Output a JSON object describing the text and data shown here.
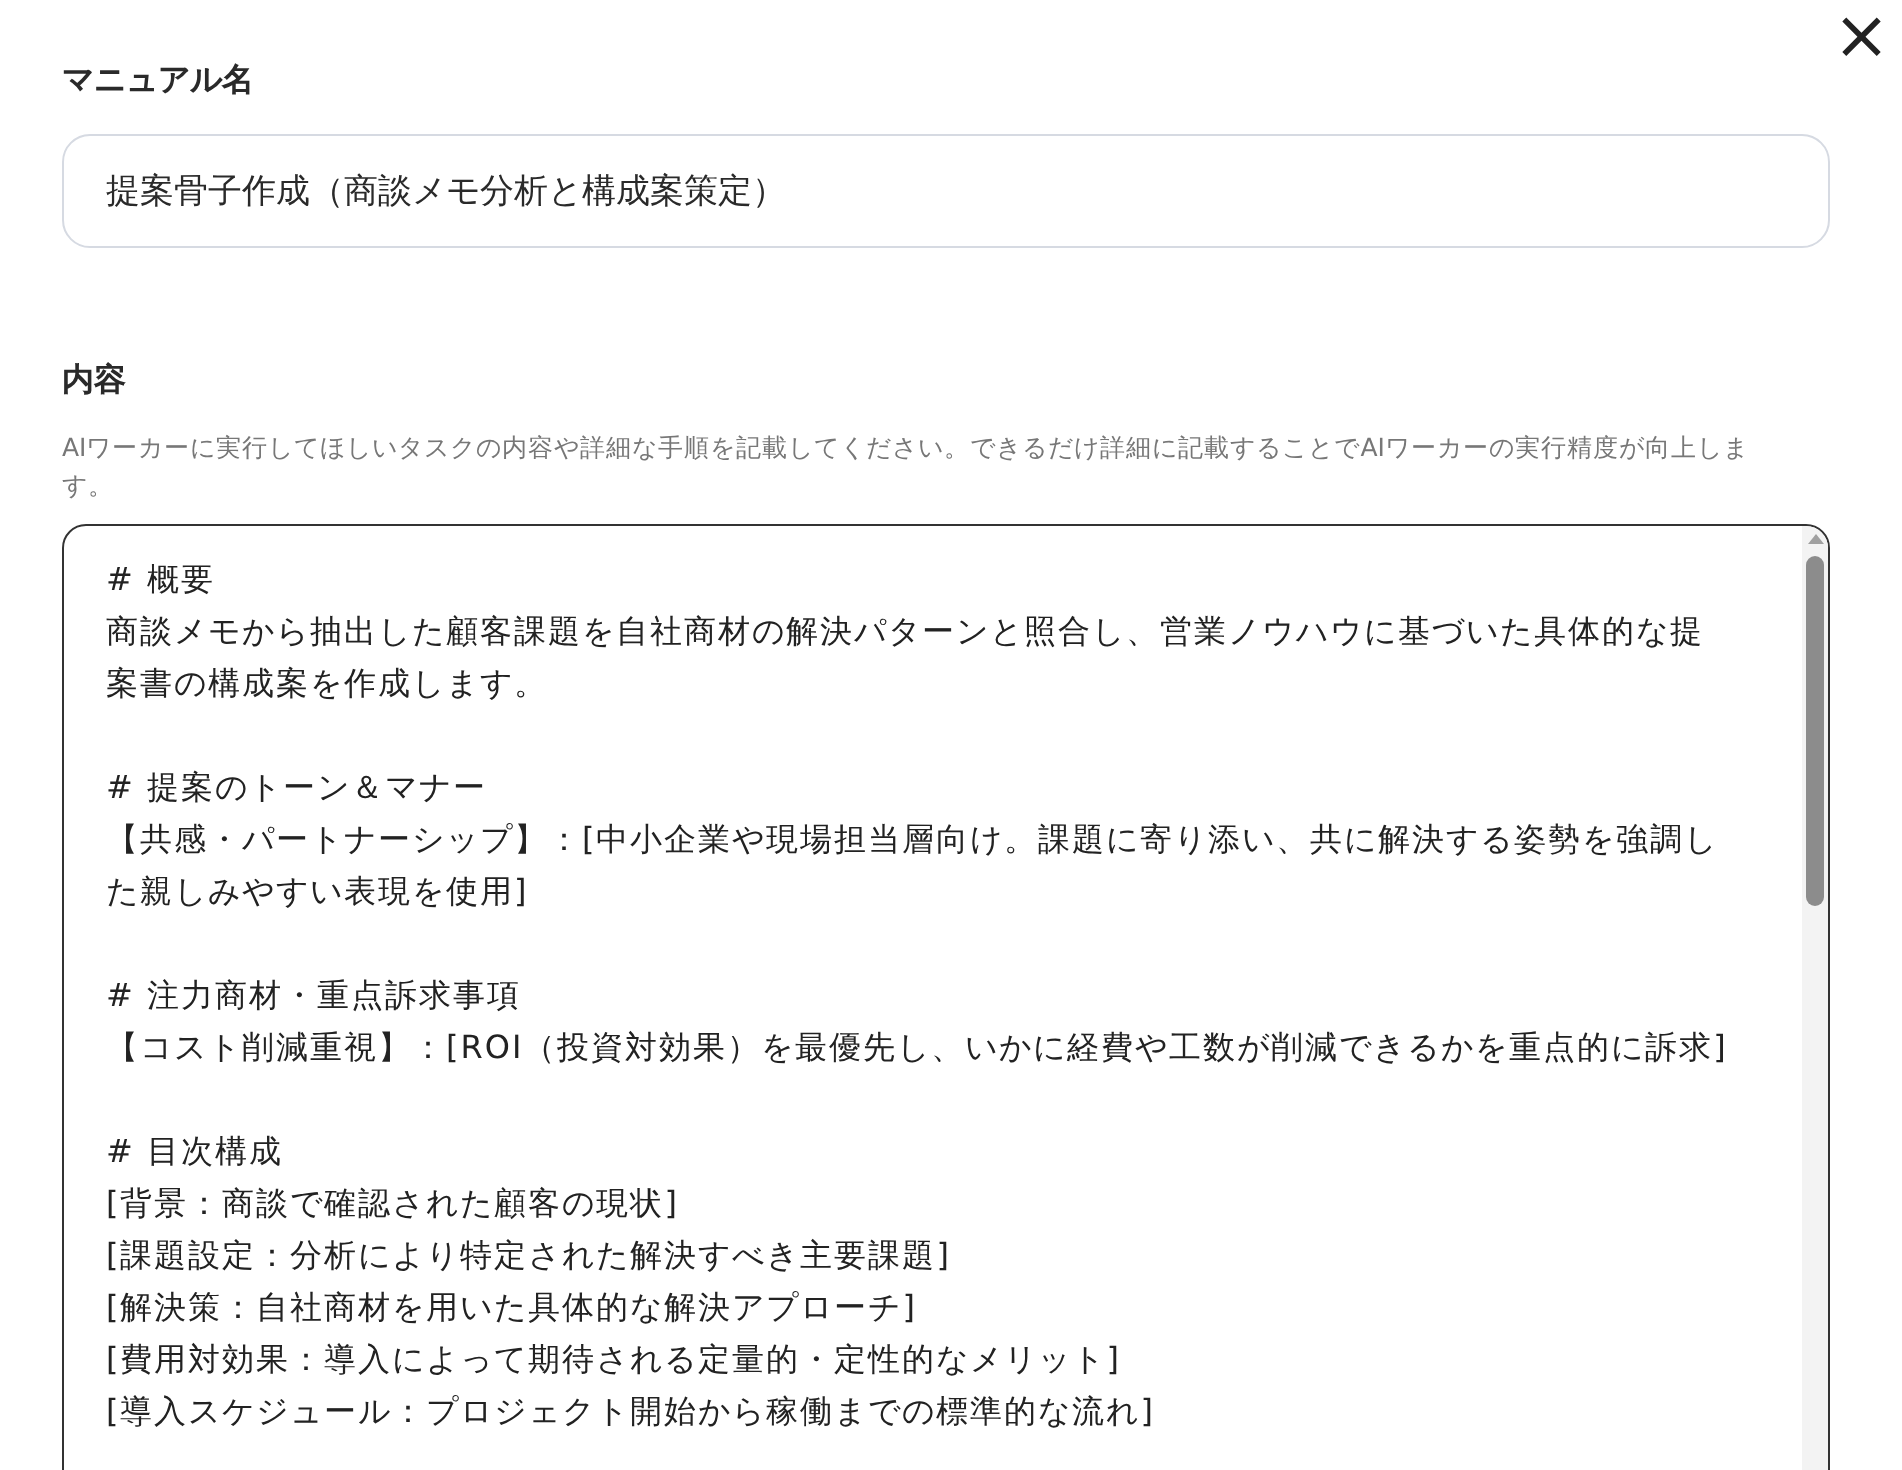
{
  "close_button": {
    "label": "×"
  },
  "manual_name": {
    "label": "マニュアル名",
    "value": "提案骨子作成（商談メモ分析と構成案策定）"
  },
  "content": {
    "label": "内容",
    "help": "AIワーカーに実行してほしいタスクの内容や詳細な手順を記載してください。できるだけ詳細に記載することでAIワーカーの実行精度が向上します。",
    "blocks": [
      {
        "lines": [
          "# 概要",
          "商談メモから抽出した顧客課題を自社商材の解決パターンと照合し、営業ノウハウに基づいた具体的な提",
          "案書の構成案を作成します。"
        ]
      },
      {
        "lines": [
          "# 提案のトーン＆マナー",
          "【共感・パートナーシップ】：[中小企業や現場担当層向け。課題に寄り添い、共に解決する姿勢を強調し",
          "た親しみやすい表現を使用]"
        ]
      },
      {
        "lines": [
          "# 注力商材・重点訴求事項",
          "【コスト削減重視】：[ROI（投資対効果）を最優先し、いかに経費や工数が削減できるかを重点的に訴求]"
        ]
      },
      {
        "lines": [
          "# 目次構成",
          "[背景：商談で確認された顧客の現状]",
          "[課題設定：分析により特定された解決すべき主要課題]",
          "[解決策：自社商材を用いた具体的な解決アプローチ]",
          "[費用対効果：導入によって期待される定量的・定性的なメリット]",
          "[導入スケジュール：プロジェクト開始から稼働までの標準的な流れ]"
        ]
      }
    ]
  }
}
